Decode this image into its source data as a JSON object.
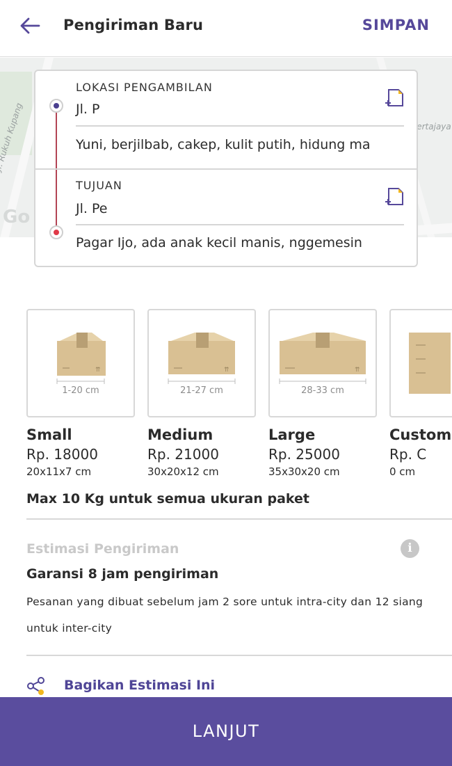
{
  "header": {
    "title": "Pengiriman Baru",
    "save_label": "SIMPAN",
    "back_icon": "arrow-left-icon"
  },
  "map": {
    "labels": [
      "Pertajaya",
      "Jl. Rukuh Kupang"
    ],
    "logo": "Go"
  },
  "pickup": {
    "label": "LOKASI PENGAMBILAN",
    "address": "Jl. P",
    "note": "Yuni, berjilbab, cakep, kulit putih, hidung ma"
  },
  "destination": {
    "label": "TUJUAN",
    "address": "Jl. Pe",
    "note": "Pagar Ijo, ada anak kecil manis, nggemesin"
  },
  "packages": [
    {
      "name": "Small",
      "price": "Rp. 18000",
      "dims": "20x11x7 cm",
      "size_caption": "1-20 cm"
    },
    {
      "name": "Medium",
      "price": "Rp. 21000",
      "dims": "30x20x12 cm",
      "size_caption": "21-27 cm"
    },
    {
      "name": "Large",
      "price": "Rp. 25000",
      "dims": "35x30x20 cm",
      "size_caption": "28-33 cm"
    },
    {
      "name": "Custom",
      "price": "Rp. C",
      "dims": "0 cm",
      "size_caption": ""
    }
  ],
  "max_weight_text": "Max 10 Kg untuk semua ukuran paket",
  "estimation": {
    "title": "Estimasi Pengiriman",
    "guarantee": "Garansi 8 jam pengiriman",
    "description": "Pesanan yang dibuat sebelum jam 2 sore untuk intra-city dan 12 siang untuk inter-city"
  },
  "share": {
    "label": "Bagikan Estimasi Ini",
    "icon": "share-icon"
  },
  "next_button": "LANJUT",
  "colors": {
    "primary": "#5a4d9e",
    "pickup_pin": "#4a3f8f",
    "destination_pin": "#e03a48",
    "route_line": "#b24454",
    "share_accent": "#f2b81e"
  }
}
